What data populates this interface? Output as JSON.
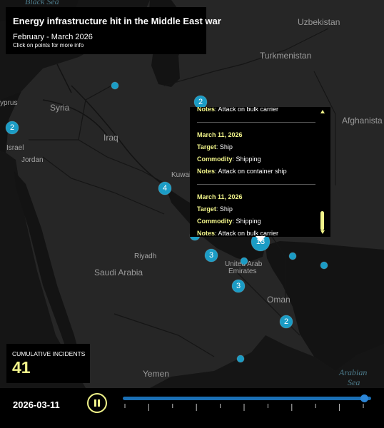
{
  "title": {
    "heading": "Energy infrastructure hit in the Middle East war",
    "dates": "February - March 2026",
    "hint": "Click on points for more info"
  },
  "map_labels": {
    "countries": {
      "syria": "Syria",
      "iraq": "Iraq",
      "turkmenistan": "Turkmenistan",
      "uzbekistan": "Uzbekistan",
      "afghanistan": "Afghanista",
      "jordan": "Jordan",
      "israel": "Israel",
      "cyprus": "yprus",
      "kuwait": "Kuwait",
      "saudi": "Saudi Arabia",
      "uae_line1": "United Arab",
      "uae_line2": "Emirates",
      "oman": "Oman",
      "yemen": "Yemen"
    },
    "cities": {
      "riyadh": "Riyadh"
    },
    "seas": {
      "black": "Black Sea",
      "arabian_line1": "Arabian",
      "arabian_line2": "Sea"
    }
  },
  "markers": [
    {
      "id": "levant",
      "count": "2"
    },
    {
      "id": "n-gulf",
      "count": "2"
    },
    {
      "id": "kuwait",
      "count": "4"
    },
    {
      "id": "bahrain",
      "count": ""
    },
    {
      "id": "qatar",
      "count": "3"
    },
    {
      "id": "uae-coast",
      "count": "3"
    },
    {
      "id": "hormuz",
      "count": "13"
    },
    {
      "id": "oman-coast",
      "count": "2"
    },
    {
      "id": "caspian",
      "count": ""
    },
    {
      "id": "gulf-oman-1",
      "count": ""
    },
    {
      "id": "gulf-oman-2",
      "count": ""
    },
    {
      "id": "dubai",
      "count": ""
    },
    {
      "id": "yemen",
      "count": ""
    }
  ],
  "popup": {
    "partial_notes_label": "Notes",
    "partial_notes_value": ": Attack on bulk carrier",
    "target_label": "Target",
    "commodity_label": "Commodity",
    "notes_label": "Notes",
    "entries": [
      {
        "date": "March 11, 2026",
        "target": ": Ship",
        "commodity": ": Shipping",
        "notes": ": Attack on container ship"
      },
      {
        "date": "March 11, 2026",
        "target": ": Ship",
        "commodity": ": Shipping",
        "notes": ": Attack on bulk carrier"
      }
    ]
  },
  "cumulative": {
    "label": "CUMULATIVE INCIDENTS",
    "value": "41"
  },
  "timeline": {
    "current_date": "2026-03-11",
    "progress": 0.98
  },
  "colors": {
    "accent": "#f2f58a",
    "marker": "#1b9cc5",
    "timeline": "#1a6fb5"
  }
}
